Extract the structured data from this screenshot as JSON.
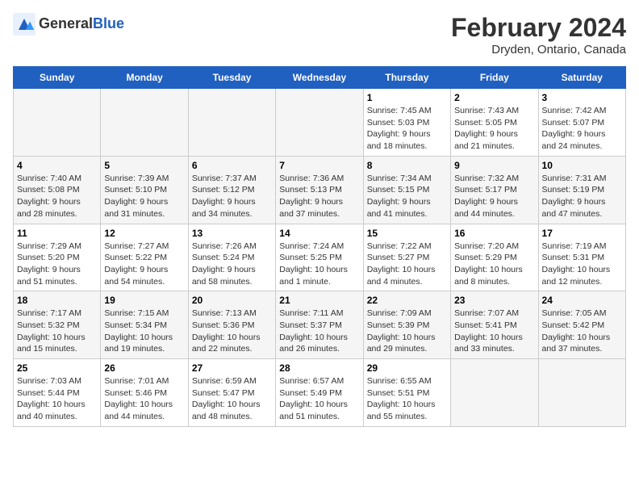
{
  "header": {
    "logo_general": "General",
    "logo_blue": "Blue",
    "month_title": "February 2024",
    "location": "Dryden, Ontario, Canada"
  },
  "days_of_week": [
    "Sunday",
    "Monday",
    "Tuesday",
    "Wednesday",
    "Thursday",
    "Friday",
    "Saturday"
  ],
  "weeks": [
    [
      {
        "day": "",
        "content": ""
      },
      {
        "day": "",
        "content": ""
      },
      {
        "day": "",
        "content": ""
      },
      {
        "day": "",
        "content": ""
      },
      {
        "day": "1",
        "content": "Sunrise: 7:45 AM\nSunset: 5:03 PM\nDaylight: 9 hours\nand 18 minutes."
      },
      {
        "day": "2",
        "content": "Sunrise: 7:43 AM\nSunset: 5:05 PM\nDaylight: 9 hours\nand 21 minutes."
      },
      {
        "day": "3",
        "content": "Sunrise: 7:42 AM\nSunset: 5:07 PM\nDaylight: 9 hours\nand 24 minutes."
      }
    ],
    [
      {
        "day": "4",
        "content": "Sunrise: 7:40 AM\nSunset: 5:08 PM\nDaylight: 9 hours\nand 28 minutes."
      },
      {
        "day": "5",
        "content": "Sunrise: 7:39 AM\nSunset: 5:10 PM\nDaylight: 9 hours\nand 31 minutes."
      },
      {
        "day": "6",
        "content": "Sunrise: 7:37 AM\nSunset: 5:12 PM\nDaylight: 9 hours\nand 34 minutes."
      },
      {
        "day": "7",
        "content": "Sunrise: 7:36 AM\nSunset: 5:13 PM\nDaylight: 9 hours\nand 37 minutes."
      },
      {
        "day": "8",
        "content": "Sunrise: 7:34 AM\nSunset: 5:15 PM\nDaylight: 9 hours\nand 41 minutes."
      },
      {
        "day": "9",
        "content": "Sunrise: 7:32 AM\nSunset: 5:17 PM\nDaylight: 9 hours\nand 44 minutes."
      },
      {
        "day": "10",
        "content": "Sunrise: 7:31 AM\nSunset: 5:19 PM\nDaylight: 9 hours\nand 47 minutes."
      }
    ],
    [
      {
        "day": "11",
        "content": "Sunrise: 7:29 AM\nSunset: 5:20 PM\nDaylight: 9 hours\nand 51 minutes."
      },
      {
        "day": "12",
        "content": "Sunrise: 7:27 AM\nSunset: 5:22 PM\nDaylight: 9 hours\nand 54 minutes."
      },
      {
        "day": "13",
        "content": "Sunrise: 7:26 AM\nSunset: 5:24 PM\nDaylight: 9 hours\nand 58 minutes."
      },
      {
        "day": "14",
        "content": "Sunrise: 7:24 AM\nSunset: 5:25 PM\nDaylight: 10 hours\nand 1 minute."
      },
      {
        "day": "15",
        "content": "Sunrise: 7:22 AM\nSunset: 5:27 PM\nDaylight: 10 hours\nand 4 minutes."
      },
      {
        "day": "16",
        "content": "Sunrise: 7:20 AM\nSunset: 5:29 PM\nDaylight: 10 hours\nand 8 minutes."
      },
      {
        "day": "17",
        "content": "Sunrise: 7:19 AM\nSunset: 5:31 PM\nDaylight: 10 hours\nand 12 minutes."
      }
    ],
    [
      {
        "day": "18",
        "content": "Sunrise: 7:17 AM\nSunset: 5:32 PM\nDaylight: 10 hours\nand 15 minutes."
      },
      {
        "day": "19",
        "content": "Sunrise: 7:15 AM\nSunset: 5:34 PM\nDaylight: 10 hours\nand 19 minutes."
      },
      {
        "day": "20",
        "content": "Sunrise: 7:13 AM\nSunset: 5:36 PM\nDaylight: 10 hours\nand 22 minutes."
      },
      {
        "day": "21",
        "content": "Sunrise: 7:11 AM\nSunset: 5:37 PM\nDaylight: 10 hours\nand 26 minutes."
      },
      {
        "day": "22",
        "content": "Sunrise: 7:09 AM\nSunset: 5:39 PM\nDaylight: 10 hours\nand 29 minutes."
      },
      {
        "day": "23",
        "content": "Sunrise: 7:07 AM\nSunset: 5:41 PM\nDaylight: 10 hours\nand 33 minutes."
      },
      {
        "day": "24",
        "content": "Sunrise: 7:05 AM\nSunset: 5:42 PM\nDaylight: 10 hours\nand 37 minutes."
      }
    ],
    [
      {
        "day": "25",
        "content": "Sunrise: 7:03 AM\nSunset: 5:44 PM\nDaylight: 10 hours\nand 40 minutes."
      },
      {
        "day": "26",
        "content": "Sunrise: 7:01 AM\nSunset: 5:46 PM\nDaylight: 10 hours\nand 44 minutes."
      },
      {
        "day": "27",
        "content": "Sunrise: 6:59 AM\nSunset: 5:47 PM\nDaylight: 10 hours\nand 48 minutes."
      },
      {
        "day": "28",
        "content": "Sunrise: 6:57 AM\nSunset: 5:49 PM\nDaylight: 10 hours\nand 51 minutes."
      },
      {
        "day": "29",
        "content": "Sunrise: 6:55 AM\nSunset: 5:51 PM\nDaylight: 10 hours\nand 55 minutes."
      },
      {
        "day": "",
        "content": ""
      },
      {
        "day": "",
        "content": ""
      }
    ]
  ]
}
